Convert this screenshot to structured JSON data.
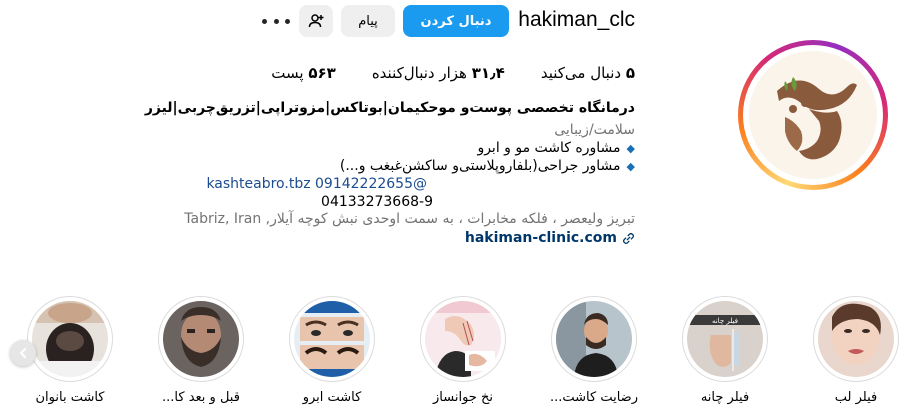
{
  "profile": {
    "username": "hakiman_clc",
    "follow_label": "دنبال کردن",
    "message_label": "پیام",
    "suggest_icon": "person-add-icon",
    "more_icon": "more-options-icon",
    "follow_color": "#1a9bf0"
  },
  "stats": {
    "posts": {
      "value": "۵۶۳",
      "label": "پست"
    },
    "followers": {
      "value": "۳۱٫۴",
      "label": "هزار دنبال‌کننده"
    },
    "following": {
      "value": "۵",
      "label": "دنبال می‌کنید"
    }
  },
  "bio": {
    "name": "درمانگاه تخصصی پوست‌و موحکیمان|بوتاکس|مزوتراپی|تزریق‌چربی|لیزر",
    "category": "سلامت/زیبایی",
    "line1": "مشاوره کاشت مو و ابرو",
    "line2": "مشاور جراحی(بلفاروپلاستی‌و ساکشن‌غبغب و...)",
    "line3": "kashteabro.tbz 09142222655@",
    "line4": "04133273668-9",
    "address": "تبریز ولیعصر ، فلکه مخابرات ، به سمت اوحدی نبش کوچه آیلار, Tabriz, Iran",
    "link": "hakiman-clinic.com"
  },
  "highlights": [
    {
      "label": "فیلر لب",
      "icon": "lips-photo"
    },
    {
      "label": "فیلر چانه",
      "icon": "chin-photo"
    },
    {
      "label": "رضایت کاشت...",
      "icon": "man-photo"
    },
    {
      "label": "نخ جوانساز",
      "icon": "face-thread-photo"
    },
    {
      "label": "کاشت ابرو",
      "icon": "eyebrow-photo"
    },
    {
      "label": "قبل و بعد کا...",
      "icon": "beard-photo"
    },
    {
      "label": "کاشت بانوان",
      "icon": "hair-photo"
    }
  ]
}
